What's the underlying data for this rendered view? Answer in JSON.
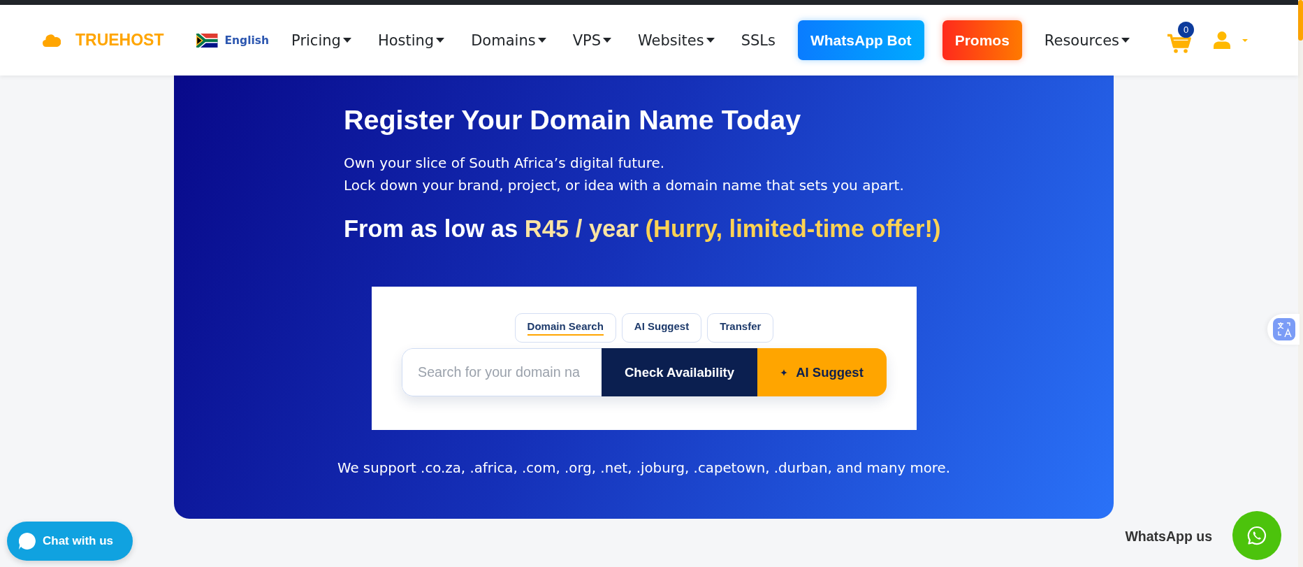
{
  "header": {
    "logo": "TRUEHOST",
    "language": "English",
    "nav": [
      {
        "label": "Pricing",
        "kind": "dropdown"
      },
      {
        "label": "Hosting",
        "kind": "dropdown"
      },
      {
        "label": "Domains",
        "kind": "dropdown"
      },
      {
        "label": "VPS",
        "kind": "dropdown"
      },
      {
        "label": "Websites",
        "kind": "dropdown"
      },
      {
        "label": "SSLs",
        "kind": "link"
      },
      {
        "label": "WhatsApp Bot",
        "kind": "bot"
      },
      {
        "label": "Promos",
        "kind": "promo"
      },
      {
        "label": "Resources",
        "kind": "dropdown"
      }
    ],
    "cart_count": "0"
  },
  "hero": {
    "title": "Register Your Domain Name Today",
    "lines": [
      "Own your slice of South Africa’s digital future.",
      "Lock down your brand, project, or idea with a domain name that sets you apart."
    ],
    "price": {
      "lead": "From as low as",
      "amount": "R45 / year",
      "offer": "(Hurry, limited-time offer!)"
    },
    "search": {
      "tabs": [
        {
          "label": "Domain Search",
          "selected": true
        },
        {
          "label": "AI Suggest",
          "selected": false
        },
        {
          "label": "Transfer",
          "selected": false
        }
      ],
      "placeholder": "Search for your domain na",
      "buttons": [
        {
          "label": "Check Availability",
          "kind": "primary"
        },
        {
          "label": "AI Suggest",
          "kind": "ai"
        }
      ]
    },
    "support_text": "We support .co.za, .africa, .com, .org, .net, .joburg, .capetown, .durban, and many more."
  },
  "chat_button": "Chat with us",
  "whatsapp": {
    "label": "WhatsApp us"
  }
}
